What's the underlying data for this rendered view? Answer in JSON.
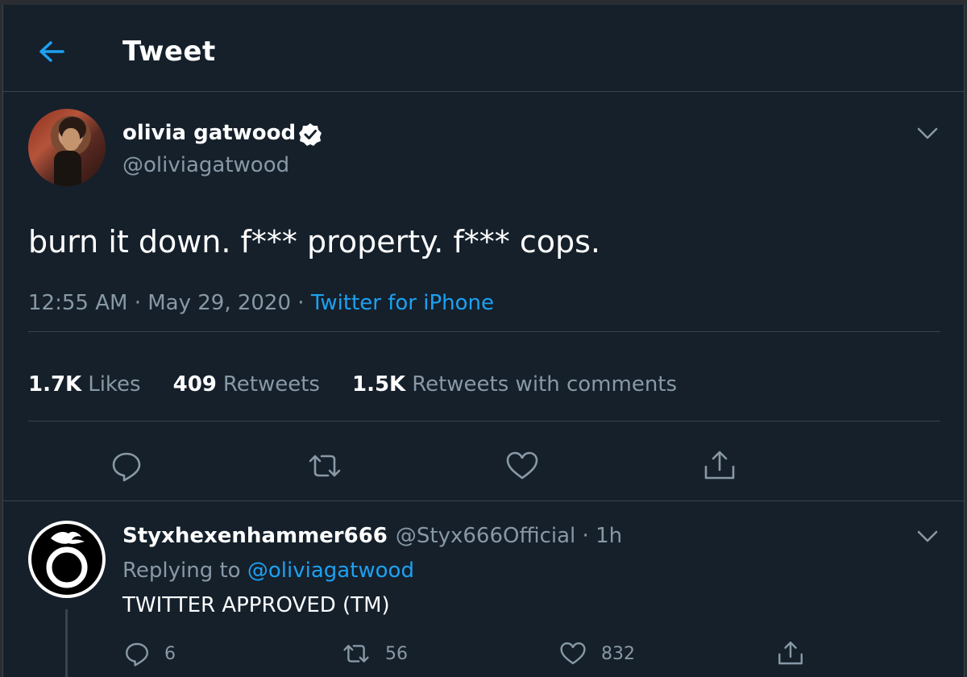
{
  "header": {
    "title": "Tweet",
    "back_icon": "arrow-left-icon",
    "accent_color": "#1da1f2"
  },
  "tweet": {
    "author_name": "olivia gatwood",
    "author_handle": "@oliviagatwood",
    "verified": true,
    "text": "burn it down. f*** property. f*** cops.",
    "time": "12:55 AM",
    "date": "May 29, 2020",
    "source": "Twitter for iPhone",
    "stats": {
      "likes_count": "1.7K",
      "likes_label": "Likes",
      "retweets_count": "409",
      "retweets_label": "Retweets",
      "quotes_count": "1.5K",
      "quotes_label": "Retweets with comments"
    },
    "actions": [
      "reply-icon",
      "retweet-icon",
      "like-icon",
      "share-icon"
    ]
  },
  "reply": {
    "author_name": "Styxhexenhammer666",
    "author_handle": "@Styx666Official",
    "age": "1h",
    "replying_prefix": "Replying to",
    "replying_mention": "@oliviagatwood",
    "text": "TWITTER APPROVED (TM)",
    "reply_count": "6",
    "retweet_count": "56",
    "like_count": "832"
  },
  "colors": {
    "background": "#15202b",
    "border": "#38444d",
    "secondary_text": "#8899a6",
    "primary_text": "#ffffff",
    "link": "#1da1f2"
  }
}
